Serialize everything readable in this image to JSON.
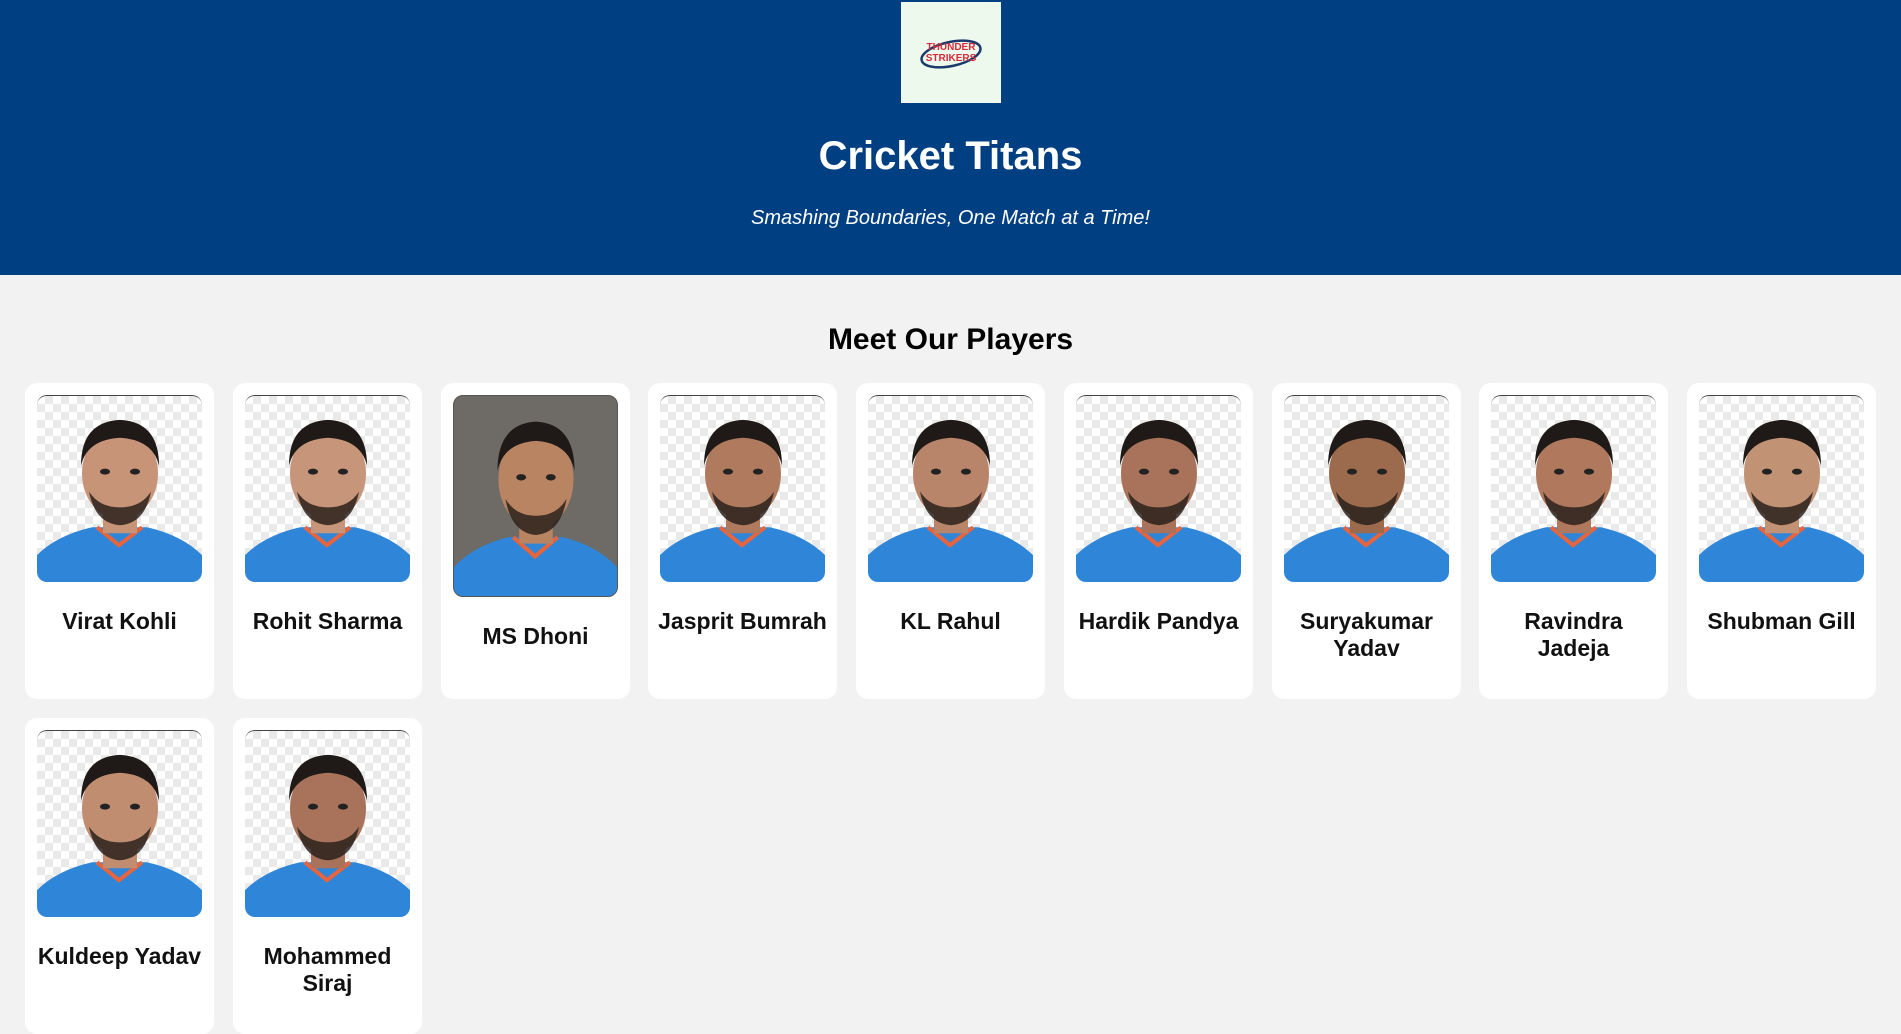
{
  "header": {
    "logo_text": "THUNDER STRIKERS",
    "title": "Cricket Titans",
    "tagline": "Smashing Boundaries, One Match at a Time!"
  },
  "section": {
    "title": "Meet Our Players"
  },
  "players": [
    {
      "name": "Virat Kohli"
    },
    {
      "name": "Rohit Sharma"
    },
    {
      "name": "MS Dhoni"
    },
    {
      "name": "Jasprit Bumrah"
    },
    {
      "name": "KL Rahul"
    },
    {
      "name": "Hardik Pandya"
    },
    {
      "name": "Suryakumar Yadav"
    },
    {
      "name": "Ravindra Jadeja"
    },
    {
      "name": "Shubman Gill"
    },
    {
      "name": "Kuldeep Yadav"
    },
    {
      "name": "Mohammed Siraj"
    }
  ],
  "colors": {
    "header_bg": "#003f82",
    "page_bg": "#f2f2f2",
    "jersey": "#2f86d8",
    "logo_text": "#d62b3b"
  }
}
